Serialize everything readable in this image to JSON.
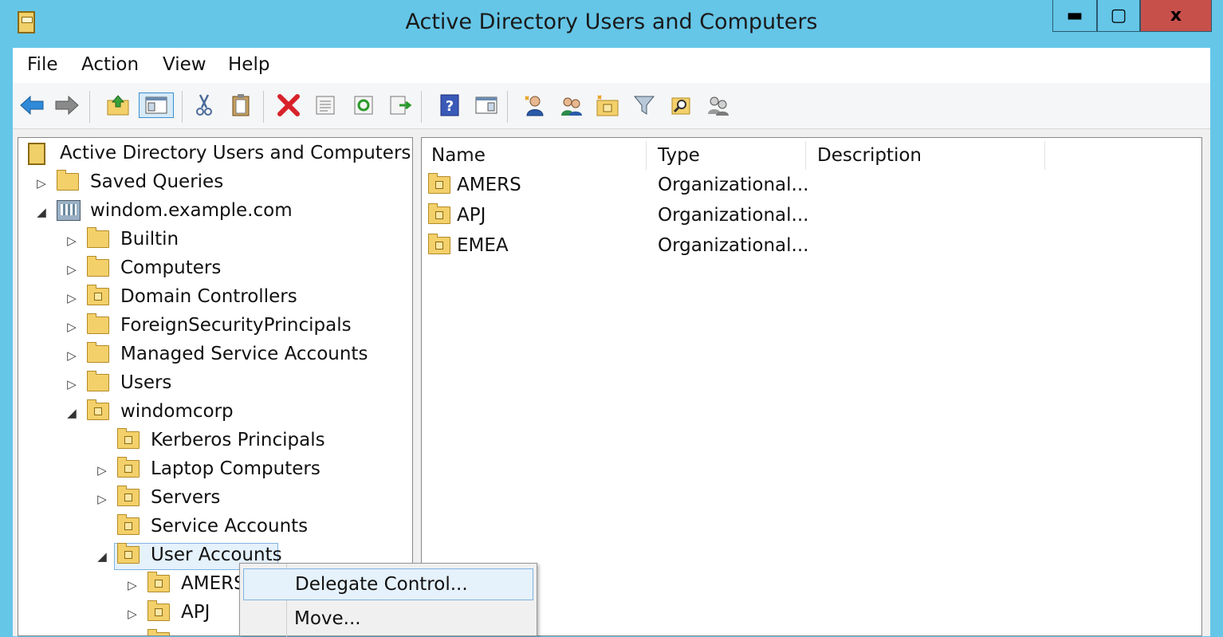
{
  "window": {
    "title": "Active Directory Users and Computers",
    "buttons": {
      "minimize": "▬",
      "maximize": "▢",
      "close": "x"
    }
  },
  "menu": [
    "File",
    "Action",
    "View",
    "Help"
  ],
  "toolbar": [
    "back-arrow-icon",
    "forward-arrow-icon",
    "up-one-level-icon",
    "show-hide-console-tree-icon",
    "cut-icon",
    "paste-icon",
    "delete-icon",
    "properties-icon",
    "refresh-icon",
    "export-list-icon",
    "help-icon",
    "show-hide-action-pane-icon",
    "new-user-icon",
    "new-group-icon",
    "new-organizational-unit-icon",
    "filter-icon",
    "find-icon",
    "add-to-group-icon"
  ],
  "tree": {
    "root": "Active Directory Users and Computers [svı",
    "saved_queries": "Saved Queries",
    "domain": "windom.example.com",
    "builtin": "Builtin",
    "computers": "Computers",
    "domain_controllers": "Domain Controllers",
    "fsp": "ForeignSecurityPrincipals",
    "msa": "Managed Service Accounts",
    "users": "Users",
    "windomcorp": "windomcorp",
    "kerberos": "Kerberos Principals",
    "laptops": "Laptop Computers",
    "servers": "Servers",
    "service_accounts": "Service Accounts",
    "user_accounts": "User Accounts",
    "amers": "AMERS",
    "apj": "APJ",
    "expander_collapsed": "▷",
    "expander_expanded": "◢"
  },
  "list": {
    "columns": [
      "Name",
      "Type",
      "Description"
    ],
    "rows": [
      {
        "name": "AMERS",
        "type": "Organizational...",
        "description": ""
      },
      {
        "name": "APJ",
        "type": "Organizational...",
        "description": ""
      },
      {
        "name": "EMEA",
        "type": "Organizational...",
        "description": ""
      }
    ]
  },
  "context_menu": {
    "items": [
      "Delegate Control...",
      "Move..."
    ],
    "highlighted": "Delegate Control..."
  },
  "colors": {
    "titlebar": "#65c6e8",
    "close_button": "#c7504b",
    "selection": "#e5f1fb",
    "selection_border": "#7fb3e0"
  }
}
